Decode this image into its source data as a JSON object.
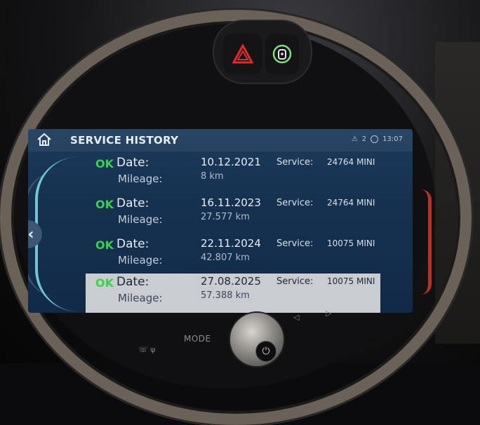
{
  "header": {
    "title": "SERVICE HISTORY",
    "warning_count": "2",
    "time": "13:07"
  },
  "entries": [
    {
      "status": "OK",
      "date_label": "Date:",
      "date": "10.12.2021",
      "mileage_label": "Mileage:",
      "mileage": "8 km",
      "service_label": "Service:",
      "service": "24764  MINI"
    },
    {
      "status": "OK",
      "date_label": "Date:",
      "date": "16.11.2023",
      "mileage_label": "Mileage:",
      "mileage": "27.577 km",
      "service_label": "Service:",
      "service": "24764  MINI"
    },
    {
      "status": "OK",
      "date_label": "Date:",
      "date": "22.11.2024",
      "mileage_label": "Mileage:",
      "mileage": "42.807 km",
      "service_label": "Service:",
      "service": "10075  MINI"
    },
    {
      "status": "OK",
      "date_label": "Date:",
      "date": "27.08.2025",
      "mileage_label": "Mileage:",
      "mileage": "57.388 km",
      "service_label": "Service:",
      "service": "10075  MINI"
    }
  ],
  "console": {
    "mode_label": "MODE"
  },
  "icons": {
    "home": "home-icon",
    "back": "chevron-left-icon",
    "hazard": "hazard-triangle-icon",
    "lock": "door-lock-icon",
    "power": "power-icon"
  },
  "colors": {
    "ok_green": "#39d24a",
    "hazard_red": "#e02a2a",
    "lock_green": "#7fe07a",
    "accent_cyan": "#6fc7d6"
  }
}
